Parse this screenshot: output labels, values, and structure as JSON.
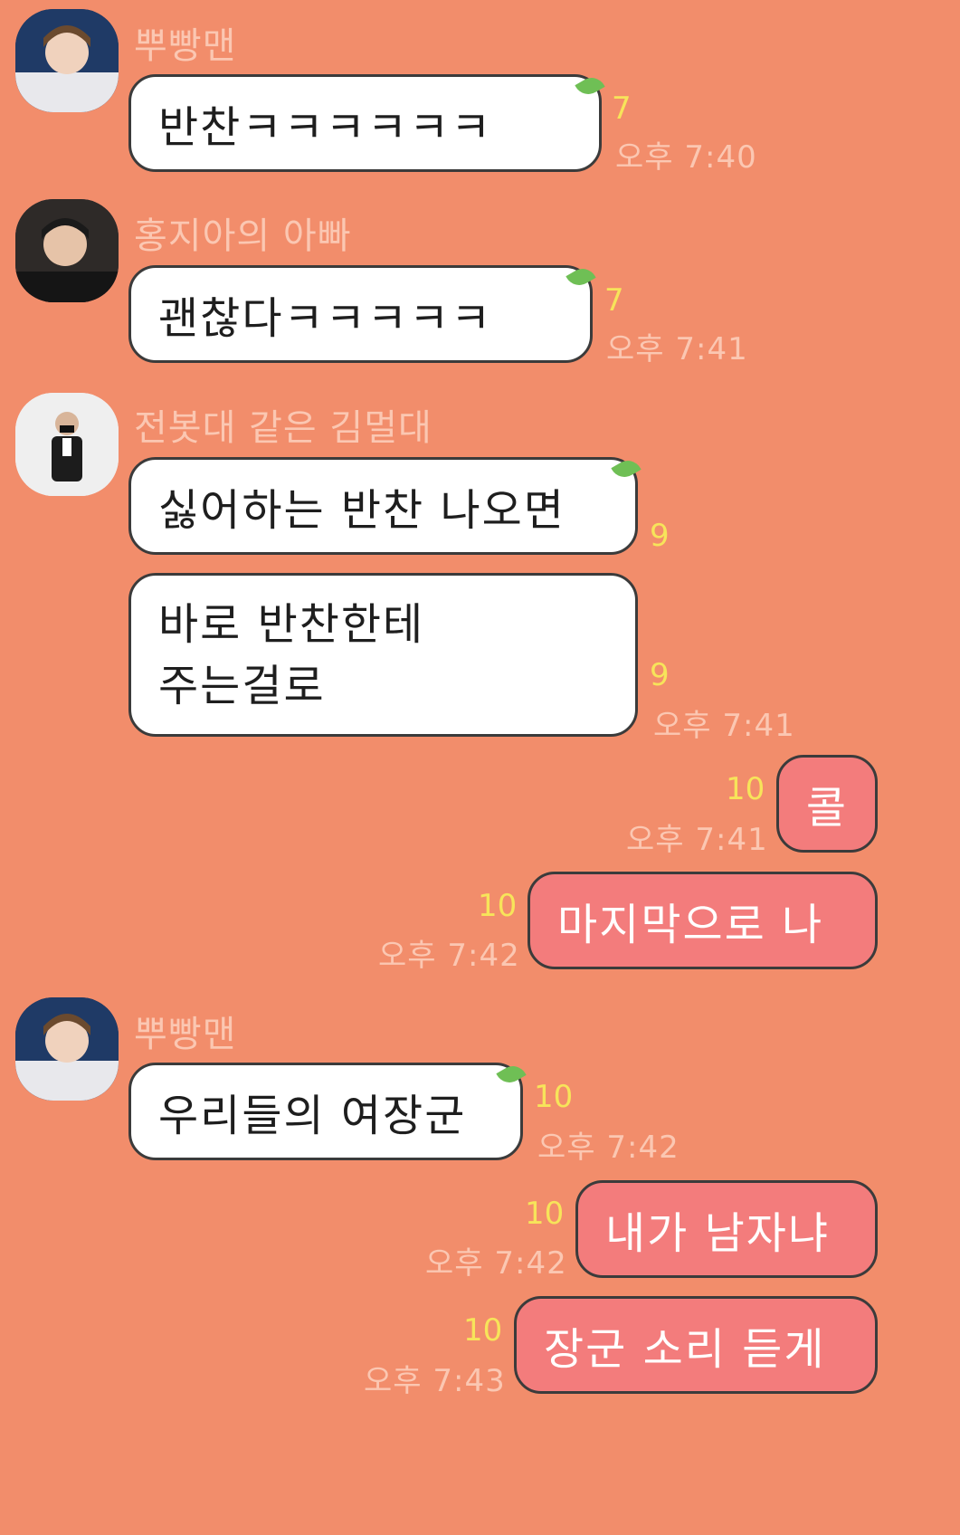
{
  "messages": [
    {
      "sender": "뿌빵맨",
      "text": "반찬ㅋㅋㅋㅋㅋㅋ",
      "count": "7",
      "time": "오후 7:40"
    },
    {
      "sender": "홍지아의 아빠",
      "text": "괜찮다ㅋㅋㅋㅋㅋ",
      "count": "7",
      "time": "오후 7:41"
    },
    {
      "sender": "전봇대 같은 김멀대",
      "text": "싫어하는 반찬 나오면",
      "count": "9"
    },
    {
      "lines": [
        "바로 반찬한테",
        "주는걸로"
      ],
      "count": "9",
      "time": "오후 7:41"
    },
    {
      "text": "콜",
      "count": "10",
      "time": "오후 7:41"
    },
    {
      "text": "마지막으로 나",
      "count": "10",
      "time": "오후 7:42"
    },
    {
      "sender": "뿌빵맨",
      "text": "우리들의 여장군",
      "count": "10",
      "time": "오후 7:42"
    },
    {
      "text": "내가 남자냐",
      "count": "10",
      "time": "오후 7:42"
    },
    {
      "text": "장군 소리 듣게",
      "count": "10",
      "time": "오후 7:43"
    }
  ],
  "colors": {
    "background": "#f28d6b",
    "incoming_bubble": "#ffffff",
    "outgoing_bubble": "#f37c7c",
    "unread_count": "#f7e45a",
    "meta_text": "#fbc7b2",
    "leaf": "#6fbf55"
  },
  "icons": [
    "avatar-pbbangman",
    "avatar-hongjia-dad",
    "avatar-kimmeoldae",
    "leaf-icon"
  ]
}
